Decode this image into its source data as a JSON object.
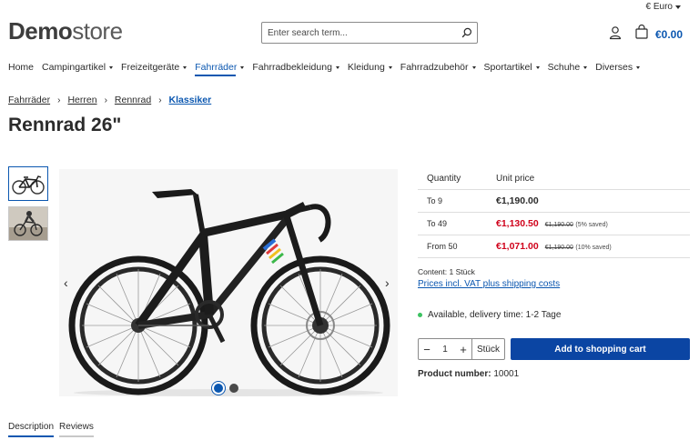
{
  "currency": {
    "label": "€ Euro"
  },
  "logo": {
    "bold": "Demo",
    "light": "store"
  },
  "search": {
    "placeholder": "Enter search term..."
  },
  "cart": {
    "total": "€0.00"
  },
  "nav": [
    {
      "label": "Home",
      "dropdown": false,
      "active": false
    },
    {
      "label": "Campingartikel",
      "dropdown": true,
      "active": false
    },
    {
      "label": "Freizeitgeräte",
      "dropdown": true,
      "active": false
    },
    {
      "label": "Fahrräder",
      "dropdown": true,
      "active": true
    },
    {
      "label": "Fahrradbekleidung",
      "dropdown": true,
      "active": false
    },
    {
      "label": "Kleidung",
      "dropdown": true,
      "active": false
    },
    {
      "label": "Fahrradzubehör",
      "dropdown": true,
      "active": false
    },
    {
      "label": "Sportartikel",
      "dropdown": true,
      "active": false
    },
    {
      "label": "Schuhe",
      "dropdown": true,
      "active": false
    },
    {
      "label": "Diverses",
      "dropdown": true,
      "active": false
    }
  ],
  "breadcrumb": [
    "Fahrräder",
    "Herren",
    "Rennrad",
    "Klassiker"
  ],
  "product": {
    "title": "Rennrad 26\"",
    "price_table": {
      "headers": [
        "Quantity",
        "Unit price"
      ],
      "rows": [
        {
          "quantity": "To 9",
          "price": "€1,190.00",
          "sale": false,
          "old": "",
          "saved": ""
        },
        {
          "quantity": "To 49",
          "price": "€1,130.50",
          "sale": true,
          "old": "€1,190.00",
          "saved": "(5% saved)"
        },
        {
          "quantity": "From 50",
          "price": "€1,071.00",
          "sale": true,
          "old": "€1,190.00",
          "saved": "(10% saved)"
        }
      ]
    },
    "content": "Content: 1 Stück",
    "shipping_link": "Prices incl. VAT plus shipping costs",
    "availability": "Available, delivery time: 1-2 Tage",
    "quantity": "1",
    "quantity_unit": "Stück",
    "add_to_cart": "Add to shopping cart",
    "product_number_label": "Product number:",
    "product_number": "10001"
  },
  "tabs": [
    "Description",
    "Reviews"
  ],
  "colors": {
    "accent": "#0b57b0",
    "button": "#0b45a3",
    "sale": "#d0021b",
    "available": "#3cc261"
  }
}
